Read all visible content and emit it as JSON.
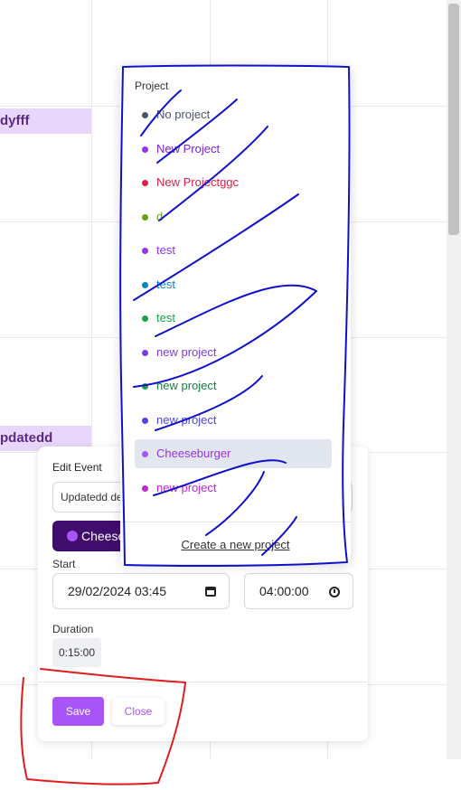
{
  "calendar": {
    "events": [
      {
        "label": "dyfff"
      },
      {
        "label": "pdatedd"
      }
    ]
  },
  "edit_event": {
    "title": "Edit Event",
    "name_value": "Updatedd de",
    "project_label": "Cheese",
    "start_label": "Start",
    "start_value": "29/02/2024  03:45",
    "end_value": "04:00:00",
    "duration_label": "Duration",
    "duration_value": "0:15:00",
    "save_label": "Save",
    "close_label": "Close"
  },
  "project_dropdown": {
    "title": "Project",
    "items": [
      {
        "label": "No project",
        "color": "#475569",
        "text_color": "#4b5563"
      },
      {
        "label": "New Project",
        "color": "#9333ea",
        "text_color": "#7e22ce"
      },
      {
        "label": "New Projectggc",
        "color": "#e11d48",
        "text_color": "#e11d48"
      },
      {
        "label": "d",
        "color": "#65a30d",
        "text_color": "#65a30d"
      },
      {
        "label": "test",
        "color": "#9333ea",
        "text_color": "#9333ea"
      },
      {
        "label": "test",
        "color": "#0284c7",
        "text_color": "#0284c7"
      },
      {
        "label": "test",
        "color": "#16a34a",
        "text_color": "#16a34a"
      },
      {
        "label": "new project",
        "color": "#7c3aed",
        "text_color": "#7c3aed"
      },
      {
        "label": "new project",
        "color": "#16a34a",
        "text_color": "#15803d"
      },
      {
        "label": "new project",
        "color": "#4f46e5",
        "text_color": "#4f46e5"
      },
      {
        "label": "Cheeseburger",
        "color": "#a855f7",
        "text_color": "#9333ea",
        "active": true
      },
      {
        "label": "new project",
        "color": "#c026d3",
        "text_color": "#c026d3"
      }
    ],
    "create_label": "Create a new project"
  }
}
